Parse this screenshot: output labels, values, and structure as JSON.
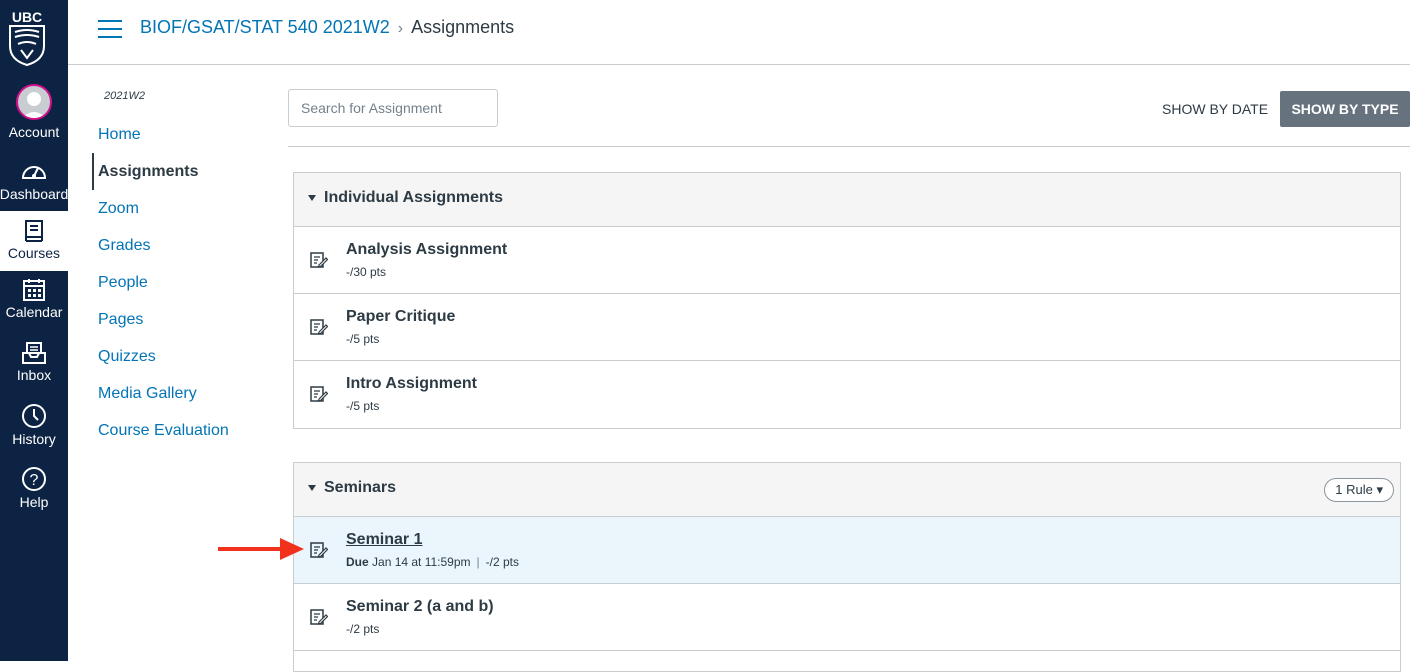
{
  "global_nav": {
    "logo_text": "UBC",
    "items": [
      {
        "label": "Account",
        "icon": "avatar"
      },
      {
        "label": "Dashboard",
        "icon": "dashboard-icon"
      },
      {
        "label": "Courses",
        "icon": "courses-icon"
      },
      {
        "label": "Calendar",
        "icon": "calendar-icon"
      },
      {
        "label": "Inbox",
        "icon": "inbox-icon"
      },
      {
        "label": "History",
        "icon": "history-icon"
      },
      {
        "label": "Help",
        "icon": "help-icon"
      }
    ],
    "active": "Courses"
  },
  "header": {
    "course": "BIOF/GSAT/STAT 540 2021W2",
    "separator": "›",
    "current": "Assignments"
  },
  "course_nav": {
    "term": "2021W2",
    "items": [
      "Home",
      "Assignments",
      "Zoom",
      "Grades",
      "People",
      "Pages",
      "Quizzes",
      "Media Gallery",
      "Course Evaluation"
    ],
    "active": "Assignments"
  },
  "toolbar": {
    "search_placeholder": "Search for Assignment",
    "show_by_date": "SHOW BY DATE",
    "show_by_type": "SHOW BY TYPE"
  },
  "groups": [
    {
      "title": "Individual Assignments",
      "assignments": [
        {
          "title": "Analysis Assignment",
          "points": "-/30 pts"
        },
        {
          "title": "Paper Critique",
          "points": "-/5 pts"
        },
        {
          "title": "Intro Assignment",
          "points": "-/5 pts"
        }
      ]
    },
    {
      "title": "Seminars",
      "rule": "1 Rule ▾",
      "assignments": [
        {
          "title": "Seminar 1",
          "due_label": "Due",
          "due": "Jan 14 at 11:59pm",
          "sep": "|",
          "points": "-/2 pts"
        },
        {
          "title": "Seminar 2 (a and b)",
          "points": "-/2 pts"
        }
      ]
    }
  ],
  "colors": {
    "nav_bg": "#0c2343",
    "link": "#0374b5",
    "highlight_row": "#eaf5fc",
    "arrow": "#f2311d",
    "button_type_bg": "#66737f"
  }
}
